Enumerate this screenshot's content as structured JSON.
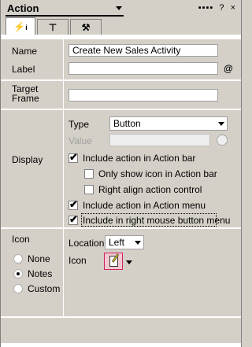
{
  "window": {
    "title": "Action"
  },
  "tabs": [
    {
      "icon": "lightning-info-icon"
    },
    {
      "icon": "hook-icon"
    },
    {
      "icon": "toolbar-person-icon"
    }
  ],
  "fields": {
    "name_label": "Name",
    "name_value": "Create New Sales Activity",
    "label_label": "Label",
    "label_value": "",
    "at_symbol": "@",
    "target_label": "Target\nFrame",
    "target_value": ""
  },
  "display": {
    "section_label": "Display",
    "type_label": "Type",
    "type_value": "Button",
    "value_label": "Value",
    "value_value": "",
    "options": [
      {
        "label": "Include action in Action bar",
        "checked": true
      },
      {
        "label": "Only show icon in Action bar",
        "checked": false
      },
      {
        "label": "Right align action control",
        "checked": false
      },
      {
        "label": "Include action in Action menu",
        "checked": true
      },
      {
        "label": "Include in right mouse button menu",
        "checked": true
      }
    ]
  },
  "icon_section": {
    "section_label": "Icon",
    "radios": [
      {
        "label": "None",
        "selected": false
      },
      {
        "label": "Notes",
        "selected": true
      },
      {
        "label": "Custom",
        "selected": false
      }
    ],
    "location_label": "Location",
    "location_value": "Left",
    "icon_label": "Icon"
  }
}
